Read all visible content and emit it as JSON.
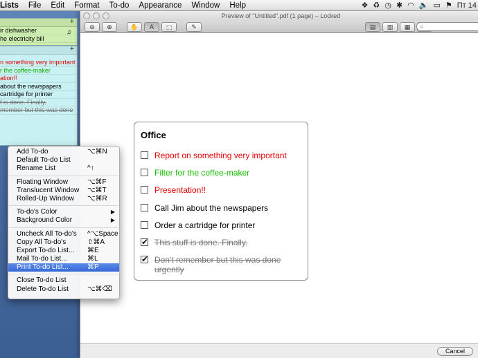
{
  "menubar": {
    "app": "Lists",
    "items": [
      "File",
      "Edit",
      "Format",
      "To-do",
      "Appearance",
      "Window",
      "Help"
    ],
    "status_right": "Пт 14"
  },
  "green_list": {
    "items": [
      {
        "text": "ir dishwasher"
      },
      {
        "text": "he electricity bill"
      }
    ]
  },
  "cyan_list": {
    "items": [
      {
        "text": "n something very important"
      },
      {
        "text": "r the coffee-maker"
      },
      {
        "text": "ation!!"
      },
      {
        "text": "about the newspapers"
      },
      {
        "text": "cartridge for printer"
      },
      {
        "text": "f is done. Finally."
      },
      {
        "text": "member but this was done"
      }
    ]
  },
  "preview": {
    "title": "Preview of \"Untitled\".pdf (1 page) – Locked",
    "cancel_label": "Cancel"
  },
  "card": {
    "title": "Office",
    "items": [
      {
        "text": "Report on something very important",
        "checked": false,
        "color": "#e80000"
      },
      {
        "text": "Filter for the coffee-maker",
        "checked": false,
        "color": "#17c000"
      },
      {
        "text": "Presentation!!",
        "checked": false,
        "color": "#e80000"
      },
      {
        "text": "Call Jim about the newspapers",
        "checked": false,
        "color": "#000000"
      },
      {
        "text": "Order a cartridge for printer",
        "checked": false,
        "color": "#000000"
      },
      {
        "text": "This stuff is done. Finally.",
        "checked": true,
        "color": "#777777"
      },
      {
        "text": "Don't remember but this was done urgently",
        "checked": true,
        "color": "#777777"
      }
    ]
  },
  "context_menu": {
    "groups": [
      [
        {
          "label": "Add To-do",
          "shortcut": "⌥⌘N"
        },
        {
          "label": "Default To-do List",
          "shortcut": ""
        },
        {
          "label": "Rename List",
          "shortcut": "^↑"
        }
      ],
      [
        {
          "label": "Floating Window",
          "shortcut": "⌥⌘F"
        },
        {
          "label": "Translucent Window",
          "shortcut": "⌥⌘T"
        },
        {
          "label": "Rolled-Up Window",
          "shortcut": "⌥⌘R"
        }
      ],
      [
        {
          "label": "To-do's Color",
          "submenu": true
        },
        {
          "label": "Background Color",
          "submenu": true
        }
      ],
      [
        {
          "label": "Uncheck All To-do's",
          "shortcut": "^⌥Space"
        },
        {
          "label": "Copy All To-do's",
          "shortcut": "⇧⌘A"
        },
        {
          "label": "Export To-do List...",
          "shortcut": "⌘E"
        },
        {
          "label": "Mail To-do List...",
          "shortcut": "⌘L"
        },
        {
          "label": "Print To-do List...",
          "shortcut": "⌘P",
          "highlighted": true
        }
      ],
      [
        {
          "label": "Close To-do List",
          "shortcut": ""
        },
        {
          "label": "Delete To-do List",
          "shortcut": "⌥⌘⌫"
        }
      ]
    ]
  },
  "colors": {
    "menu_highlight": "#3768d8",
    "green_list_bg": "#cdeeb0",
    "cyan_list_bg": "#c9f1f4",
    "desktop": "#4a6fa3"
  }
}
